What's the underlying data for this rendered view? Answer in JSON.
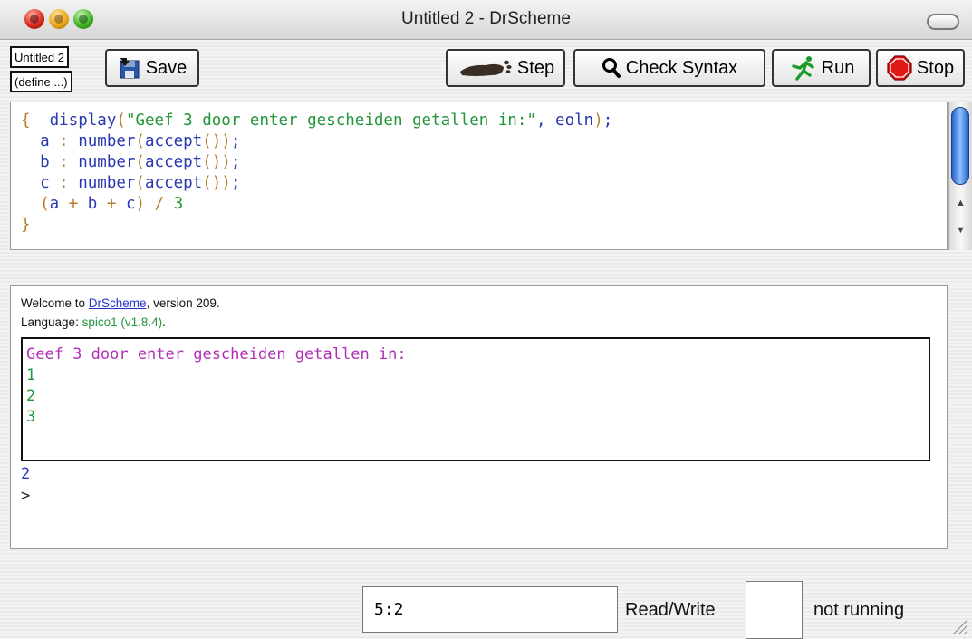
{
  "window": {
    "title": "Untitled 2 - DrScheme"
  },
  "toolbar": {
    "file_name": "Untitled 2",
    "define_menu": "(define ...)",
    "save_label": "Save",
    "step_label": "Step",
    "check_syntax_label": "Check Syntax",
    "run_label": "Run",
    "stop_label": "Stop"
  },
  "editor": {
    "lines": [
      [
        [
          "c-brace",
          "{"
        ],
        [
          "",
          "  "
        ],
        [
          "c-id",
          "display"
        ],
        [
          "c-paren",
          "("
        ],
        [
          "c-str",
          "\"Geef 3 door enter gescheiden getallen in:\""
        ],
        [
          "c-id",
          ", eoln"
        ],
        [
          "c-paren",
          ")"
        ],
        [
          "c-id",
          ";"
        ]
      ],
      [
        [
          "",
          "  "
        ],
        [
          "c-id",
          "a"
        ],
        [
          "c-op",
          " : "
        ],
        [
          "c-id",
          "number"
        ],
        [
          "c-paren",
          "("
        ],
        [
          "c-id",
          "accept"
        ],
        [
          "c-paren",
          "()"
        ],
        [
          "c-paren",
          ")"
        ],
        [
          "c-id",
          ";"
        ]
      ],
      [
        [
          "",
          "  "
        ],
        [
          "c-id",
          "b"
        ],
        [
          "c-op",
          " : "
        ],
        [
          "c-id",
          "number"
        ],
        [
          "c-paren",
          "("
        ],
        [
          "c-id",
          "accept"
        ],
        [
          "c-paren",
          "()"
        ],
        [
          "c-paren",
          ")"
        ],
        [
          "c-id",
          ";"
        ]
      ],
      [
        [
          "",
          "  "
        ],
        [
          "c-id",
          "c"
        ],
        [
          "c-op",
          " : "
        ],
        [
          "c-id",
          "number"
        ],
        [
          "c-paren",
          "("
        ],
        [
          "c-id",
          "accept"
        ],
        [
          "c-paren",
          "()"
        ],
        [
          "c-paren",
          ")"
        ],
        [
          "c-id",
          ";"
        ]
      ],
      [
        [
          "",
          "  "
        ],
        [
          "c-paren",
          "("
        ],
        [
          "c-id",
          "a"
        ],
        [
          "c-op",
          " + "
        ],
        [
          "c-id",
          "b"
        ],
        [
          "c-op",
          " + "
        ],
        [
          "c-id",
          "c"
        ],
        [
          "c-paren",
          ")"
        ],
        [
          "c-op",
          " / "
        ],
        [
          "c-num",
          "3"
        ]
      ],
      [
        [
          "c-brace",
          "}"
        ]
      ]
    ]
  },
  "interactions": {
    "welcome_prefix": "Welcome to ",
    "welcome_link": "DrScheme",
    "welcome_suffix": ", version 209.",
    "language_prefix": "Language: ",
    "language_value": "spico1 (v1.8.4)",
    "language_suffix": ".",
    "io_prompt": "Geef 3 door enter gescheiden getallen in:",
    "io_inputs": [
      "1",
      "2",
      "3"
    ],
    "result": "2",
    "repl_prompt": ">"
  },
  "status": {
    "position": "5:2",
    "mode": "Read/Write",
    "running": "not running"
  },
  "colors": {
    "keyword": "#2a38b0",
    "string": "#21963a",
    "paren": "#b87b2c",
    "io_prompt": "#b02fb8"
  }
}
